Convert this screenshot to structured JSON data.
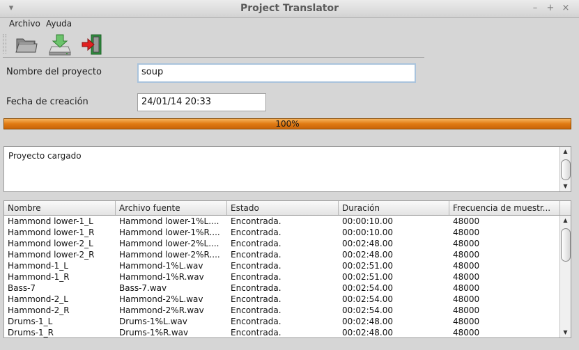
{
  "window": {
    "title": "Project Translator"
  },
  "menu": [
    "Archivo",
    "Ayuda"
  ],
  "toolbar": [
    {
      "name": "open-project-button",
      "icon": "folder-icon"
    },
    {
      "name": "translate-button",
      "icon": "drive-download-icon"
    },
    {
      "name": "exit-button",
      "icon": "exit-door-icon"
    }
  ],
  "form": {
    "project_name_label": "Nombre del proyecto",
    "project_name_value": "soup",
    "date_label": "Fecha de creación",
    "date_value": "24/01/14 20:33"
  },
  "progress": {
    "percent": 100,
    "text": "100%"
  },
  "log": {
    "text": "Proyecto cargado"
  },
  "table": {
    "columns": [
      "Nombre",
      "Archivo fuente",
      "Estado",
      "Duración",
      "Frecuencia de muestr..."
    ],
    "rows": [
      [
        "Hammond lower-1_L",
        "Hammond lower-1%L....",
        "Encontrada.",
        "00:00:10.00",
        "48000"
      ],
      [
        "Hammond lower-1_R",
        "Hammond lower-1%R....",
        "Encontrada.",
        "00:00:10.00",
        "48000"
      ],
      [
        "Hammond lower-2_L",
        "Hammond lower-2%L....",
        "Encontrada.",
        "00:02:48.00",
        "48000"
      ],
      [
        "Hammond lower-2_R",
        "Hammond lower-2%R....",
        "Encontrada.",
        "00:02:48.00",
        "48000"
      ],
      [
        "Hammond-1_L",
        "Hammond-1%L.wav",
        "Encontrada.",
        "00:02:51.00",
        "48000"
      ],
      [
        "Hammond-1_R",
        "Hammond-1%R.wav",
        "Encontrada.",
        "00:02:51.00",
        "48000"
      ],
      [
        "Bass-7",
        "Bass-7.wav",
        "Encontrada.",
        "00:02:54.00",
        "48000"
      ],
      [
        "Hammond-2_L",
        "Hammond-2%L.wav",
        "Encontrada.",
        "00:02:54.00",
        "48000"
      ],
      [
        "Hammond-2_R",
        "Hammond-2%R.wav",
        "Encontrada.",
        "00:02:54.00",
        "48000"
      ],
      [
        "Drums-1_L",
        "Drums-1%L.wav",
        "Encontrada.",
        "00:02:48.00",
        "48000"
      ],
      [
        "Drums-1_R",
        "Drums-1%R.wav",
        "Encontrada.",
        "00:02:48.00",
        "48000"
      ]
    ]
  },
  "colors": {
    "progress": "#e07a12",
    "focus_border": "#a9c3dc"
  }
}
